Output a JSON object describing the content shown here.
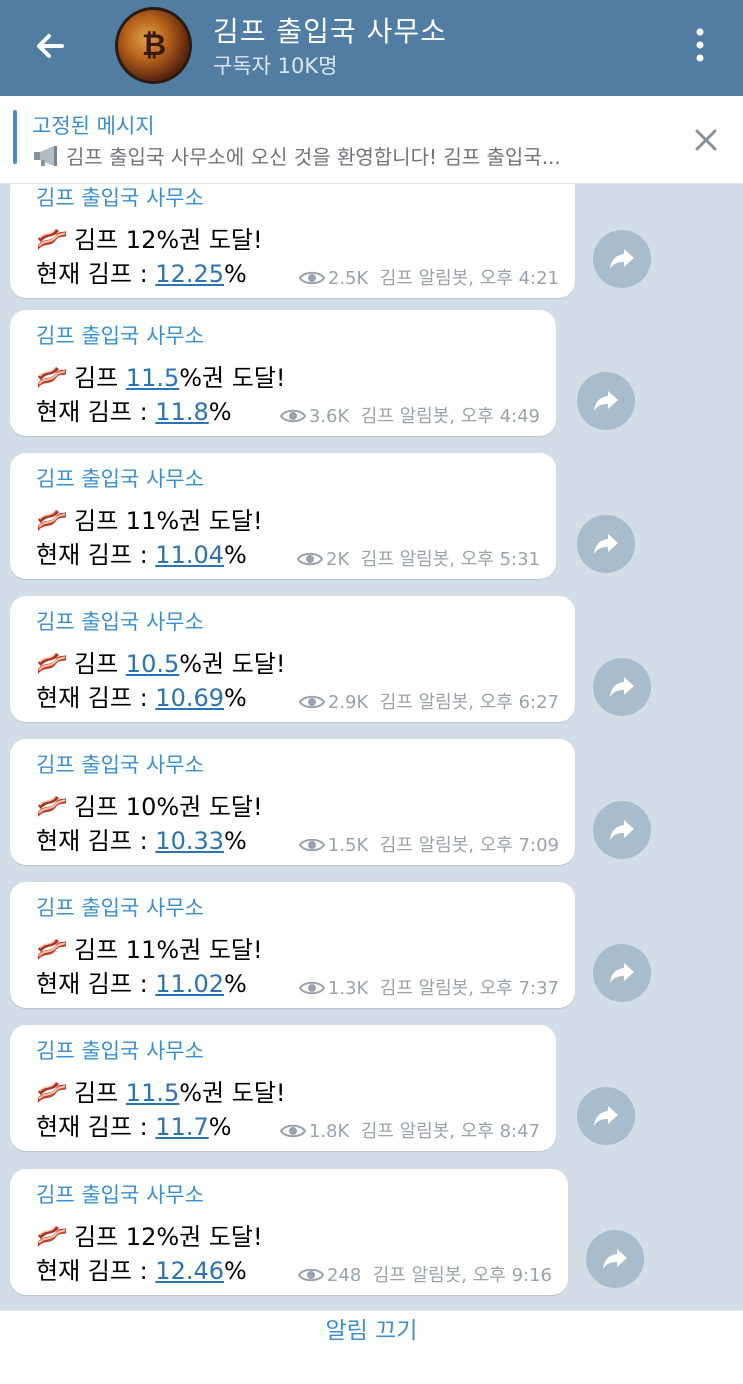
{
  "header": {
    "title": "김프 출입국 사무소",
    "subtitle": "구독자 10K명"
  },
  "pinned": {
    "title": "고정된 메시지",
    "text": "김프 출입국 사무소에 오신 것을 환영합니다! 김프 출입국..."
  },
  "messages": [
    {
      "sender": "김프 출입국 사무소",
      "pre": "김프 ",
      "level": "",
      "post": "12%권 도달!",
      "current_label": "현재 김프 : ",
      "current": "12.25",
      "views": "2.5K",
      "author_time": "김프 알림봇, 오후 4:21"
    },
    {
      "sender": "김프 출입국 사무소",
      "pre": "김프 ",
      "level": "11.5",
      "post": "%권 도달!",
      "current_label": "현재 김프 : ",
      "current": "11.8",
      "views": "3.6K",
      "author_time": "김프 알림봇, 오후 4:49"
    },
    {
      "sender": "김프 출입국 사무소",
      "pre": "김프 ",
      "level": "",
      "post": "11%권 도달!",
      "current_label": "현재 김프 : ",
      "current": "11.04",
      "views": "2K",
      "author_time": "김프 알림봇, 오후 5:31"
    },
    {
      "sender": "김프 출입국 사무소",
      "pre": "김프 ",
      "level": "10.5",
      "post": "%권 도달!",
      "current_label": "현재 김프 : ",
      "current": "10.69",
      "views": "2.9K",
      "author_time": "김프 알림봇, 오후 6:27"
    },
    {
      "sender": "김프 출입국 사무소",
      "pre": "김프 ",
      "level": "",
      "post": "10%권 도달!",
      "current_label": "현재 김프 : ",
      "current": "10.33",
      "views": "1.5K",
      "author_time": "김프 알림봇, 오후 7:09"
    },
    {
      "sender": "김프 출입국 사무소",
      "pre": "김프 ",
      "level": "",
      "post": "11%권 도달!",
      "current_label": "현재 김프 : ",
      "current": "11.02",
      "views": "1.3K",
      "author_time": "김프 알림봇, 오후 7:37"
    },
    {
      "sender": "김프 출입국 사무소",
      "pre": "김프 ",
      "level": "11.5",
      "post": "%권 도달!",
      "current_label": "현재 김프 : ",
      "current": "11.7",
      "views": "1.8K",
      "author_time": "김프 알림봇, 오후 8:47"
    },
    {
      "sender": "김프 출입국 사무소",
      "pre": "김프 ",
      "level": "",
      "post": "12%권 도달!",
      "current_label": "현재 김프 : ",
      "current": "12.46",
      "views": "248",
      "author_time": "김프 알림봇, 오후 9:16"
    }
  ],
  "percent_sign": "%",
  "footer": {
    "mute_label": "알림 끄기"
  },
  "colors": {
    "header_bg": "#517da2",
    "accent": "#3a8fd0",
    "link": "#2c73b3",
    "chat_bg": "#d3dde7"
  }
}
